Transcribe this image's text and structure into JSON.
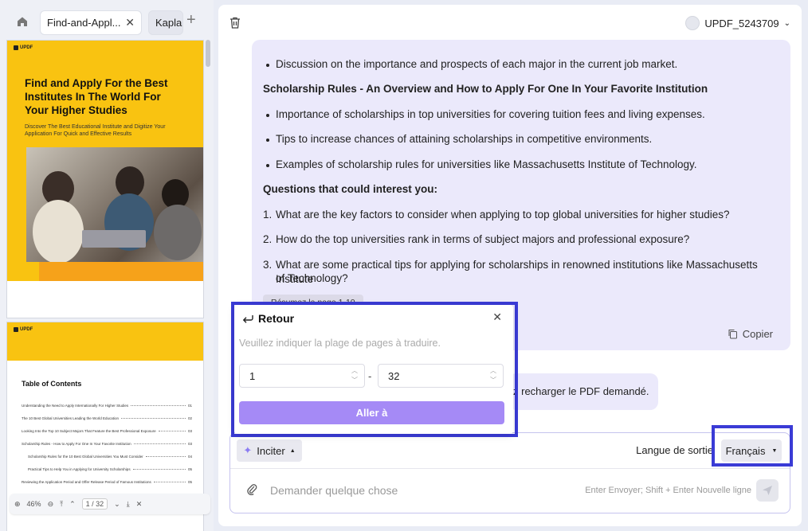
{
  "tabs": {
    "active_label": "Find-and-Appl...",
    "inactive_label": "Kaplan"
  },
  "thumb1": {
    "logo": "UPDF",
    "title": "Find and Apply For the Best Institutes In The World For Your Higher Studies",
    "subtitle": "Discover The Best Educational Institute and Digitize Your Application For Quick and Effective Results"
  },
  "thumb2": {
    "logo": "UPDF",
    "toc_title": "Table of Contents",
    "toc": [
      {
        "text": "Understanding the Need to Apply Internationally For Higher Studies",
        "page": "01"
      },
      {
        "text": "The 10 Best Global Universities Leading the World Education",
        "page": "02"
      },
      {
        "text": "Looking Into the Top 10 Subject Majors That Feature the Best Professional Exposure",
        "page": "03"
      },
      {
        "text": "Scholarship Rules - How to Apply For One In Your Favorite Institution",
        "page": "03"
      },
      {
        "text": "Scholarship Rules for the 10 Best Global Universities You Must Consider",
        "page": "04"
      },
      {
        "text": "Practical Tips to Help You in Applying for University Scholarships",
        "page": "05"
      },
      {
        "text": "Reviewing the Application Period and Offer Release Period of Famous Institutions",
        "page": "05"
      }
    ]
  },
  "zoombar": {
    "zoom": "46%",
    "page": "1 / 32"
  },
  "header": {
    "user": "UPDF_5243709"
  },
  "chat": {
    "lines": [
      "Discussion on the importance and prospects of each major in the current job market.",
      "Scholarship Rules - An Overview and How to Apply For One In Your Favorite Institution",
      "Importance of scholarships in top universities for covering tuition fees and living expenses.",
      "Tips to increase chances of attaining scholarships in competitive environments.",
      "Examples of scholarship rules for universities like Massachusetts Institute of Technology.",
      "Questions that could interest you:",
      "1.",
      "What are the key factors to consider when applying to top global universities for higher studies?",
      "2.",
      "How do the top universities rank in terms of subject majors and professional exposure?",
      "3.",
      "What are some practical tips for applying for scholarships in renowned institutions like Massachusetts Institute",
      "of Technology?"
    ],
    "pill": "Résumez la page 1-10",
    "copy": "Copier",
    "second_message": "z recharger le PDF demandé."
  },
  "popup": {
    "back": "Retour",
    "hint": "Veuillez indiquer la plage de pages à traduire.",
    "from": "1",
    "to": "32",
    "dash": "-",
    "button": "Aller à"
  },
  "input": {
    "inciter": "Inciter",
    "output_label": "Langue de sortie",
    "language": "Français",
    "placeholder": "Demander quelque chose",
    "hint": "Enter Envoyer; Shift + Enter Nouvelle ligne"
  },
  "colors": {
    "accent": "#a58af6",
    "highlight": "#3a3bd6",
    "bubble": "#ebe9fb",
    "thumb_yellow": "#f9c311"
  }
}
